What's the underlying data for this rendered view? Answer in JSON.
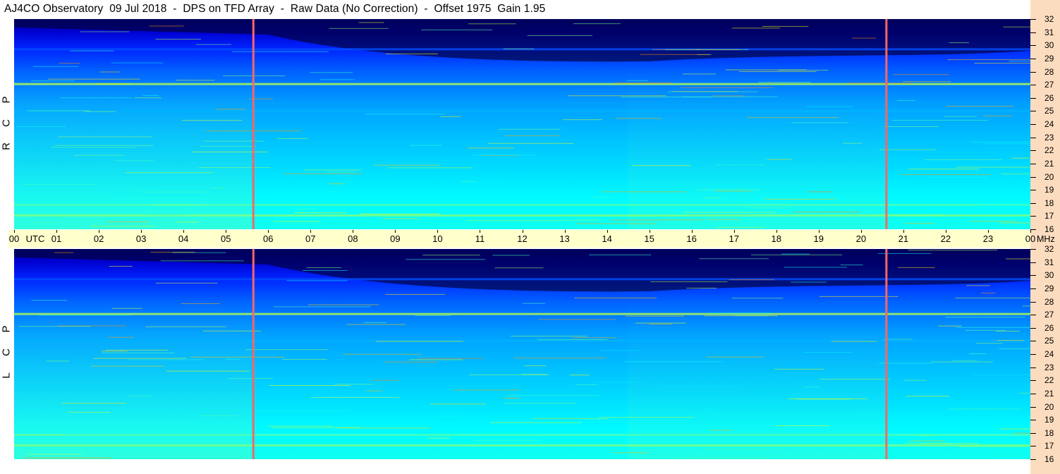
{
  "title": "AJ4CO Observatory  09 Jul 2018  -  DPS on TFD Array  -  Raw Data (No Correction)  -  Offset 1975  Gain 1.95",
  "panels": [
    {
      "id": "rcp",
      "label_letters": [
        "R",
        "C",
        "P"
      ]
    },
    {
      "id": "lcp",
      "label_letters": [
        "L",
        "C",
        "P"
      ]
    }
  ],
  "time_axis": {
    "labels": [
      "00",
      "01",
      "02",
      "03",
      "04",
      "05",
      "06",
      "07",
      "08",
      "09",
      "10",
      "11",
      "12",
      "13",
      "14",
      "15",
      "16",
      "17",
      "18",
      "19",
      "20",
      "21",
      "22",
      "23",
      "00"
    ],
    "utc_label": "UTC",
    "mhz_label": "MHz"
  },
  "colors": {
    "background_low": "#000033",
    "background_mid": "#0044cc",
    "background_high": "#33ccee",
    "interference_line": "#ff6666",
    "time_axis_bg": "#ffffcc",
    "freq_axis_bg": "#fcdcbf"
  },
  "chart_data": {
    "type": "heatmap",
    "title": "AJ4CO Observatory  09 Jul 2018  -  DPS on TFD Array  -  Raw Data (No Correction)  -  Offset 1975  Gain 1.95",
    "xlabel": "UTC",
    "ylabel": "MHz",
    "x_range_hours": [
      0,
      24
    ],
    "y_range_mhz": [
      16,
      32
    ],
    "y_ticks": [
      32,
      31,
      30,
      29,
      28,
      27,
      26,
      25,
      24,
      23,
      22,
      21,
      20,
      19,
      18,
      17,
      16
    ],
    "x_ticks": [
      "00",
      "01",
      "02",
      "03",
      "04",
      "05",
      "06",
      "07",
      "08",
      "09",
      "10",
      "11",
      "12",
      "13",
      "14",
      "15",
      "16",
      "17",
      "18",
      "19",
      "20",
      "21",
      "22",
      "23",
      "00"
    ],
    "series": [
      {
        "name": "RCP"
      },
      {
        "name": "LCP"
      }
    ],
    "vertical_interference_hours": [
      5.65,
      20.6
    ],
    "strong_band_mhz": [
      27.05,
      17.05,
      17.85,
      25.0,
      29.7
    ],
    "colormap": "jet"
  }
}
